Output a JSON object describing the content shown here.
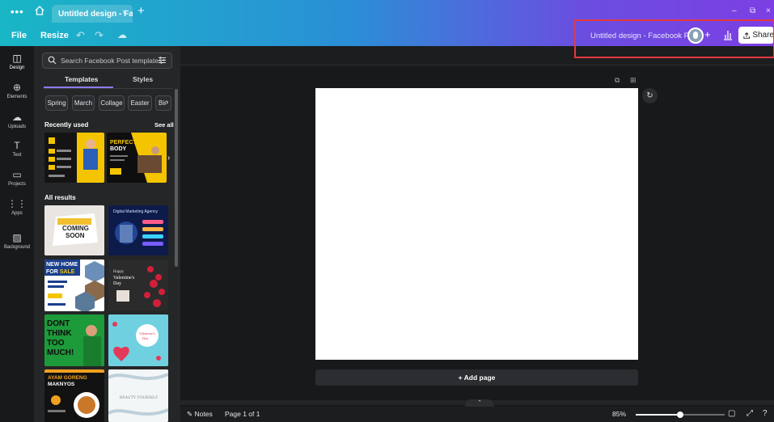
{
  "tabbar": {
    "menu_dots": "•••",
    "tab_title": "Untitled design - Face...",
    "tab_close": "×",
    "new_tab": "+",
    "win_min": "–",
    "win_restore": "⧉",
    "win_close": "×"
  },
  "toolbar": {
    "file": "File",
    "resize": "Resize",
    "undo": "↶",
    "redo": "↷",
    "cloud": "☁",
    "doc_title": "Untitled design - Facebook Post",
    "add_collab": "+",
    "share": "Share"
  },
  "rail": {
    "items": [
      {
        "label": "Design",
        "icon": "◫"
      },
      {
        "label": "Elements",
        "icon": "⊕"
      },
      {
        "label": "Uploads",
        "icon": "☁"
      },
      {
        "label": "Text",
        "icon": "T"
      },
      {
        "label": "Projects",
        "icon": "▭"
      },
      {
        "label": "Apps",
        "icon": "⋮⋮"
      },
      {
        "label": "Background",
        "icon": "▨"
      }
    ]
  },
  "panel": {
    "search_placeholder": "Search Facebook Post templates",
    "tabs": [
      "Templates",
      "Styles"
    ],
    "chips": [
      "Spring",
      "March",
      "Collage",
      "Easter",
      "Bir"
    ],
    "recently_used": "Recently used",
    "see_all": "See all",
    "all_results": "All results",
    "recent_thumbs": [
      {
        "name": "recent-template-1",
        "bg": "#111111",
        "accent": "#f5c400"
      },
      {
        "name": "recent-template-2",
        "bg": "#0e0e0e",
        "accent": "#f5c400",
        "text": "PERFECT BODY"
      }
    ],
    "results": [
      {
        "text": "COMING SOON",
        "bg": "#e9e6e2",
        "accent": "#f0c030"
      },
      {
        "text": "Digital Marketing Agency",
        "bg": "#0d1b4a",
        "accent": "#3a6fe3"
      },
      {
        "text": "NEW HOME FOR SALE",
        "bg": "#ffffff",
        "accent": "#1a3f8c"
      },
      {
        "text": "Happy Valentine's Day",
        "bg": "#2b2b2b",
        "accent": "#d31f3a"
      },
      {
        "text": "DONT THINK TOO MUCH",
        "bg": "#1d9a3a",
        "accent": "#0d0d0d"
      },
      {
        "text": "Valentine's Day",
        "bg": "#6fd0e0",
        "accent": "#e33a5a"
      },
      {
        "text": "AYAM GORENG MAKNYOS",
        "bg": "#121212",
        "accent": "#f0a020"
      },
      {
        "text": "Beauty",
        "bg": "#f3f6f7",
        "accent": "#9ab8c8"
      }
    ]
  },
  "canvas": {
    "add_page": "+ Add page"
  },
  "footer": {
    "notes": "Notes",
    "page_of": "Page 1 of 1",
    "zoom": "85%",
    "zoom_value": 0.85,
    "help": "?"
  }
}
